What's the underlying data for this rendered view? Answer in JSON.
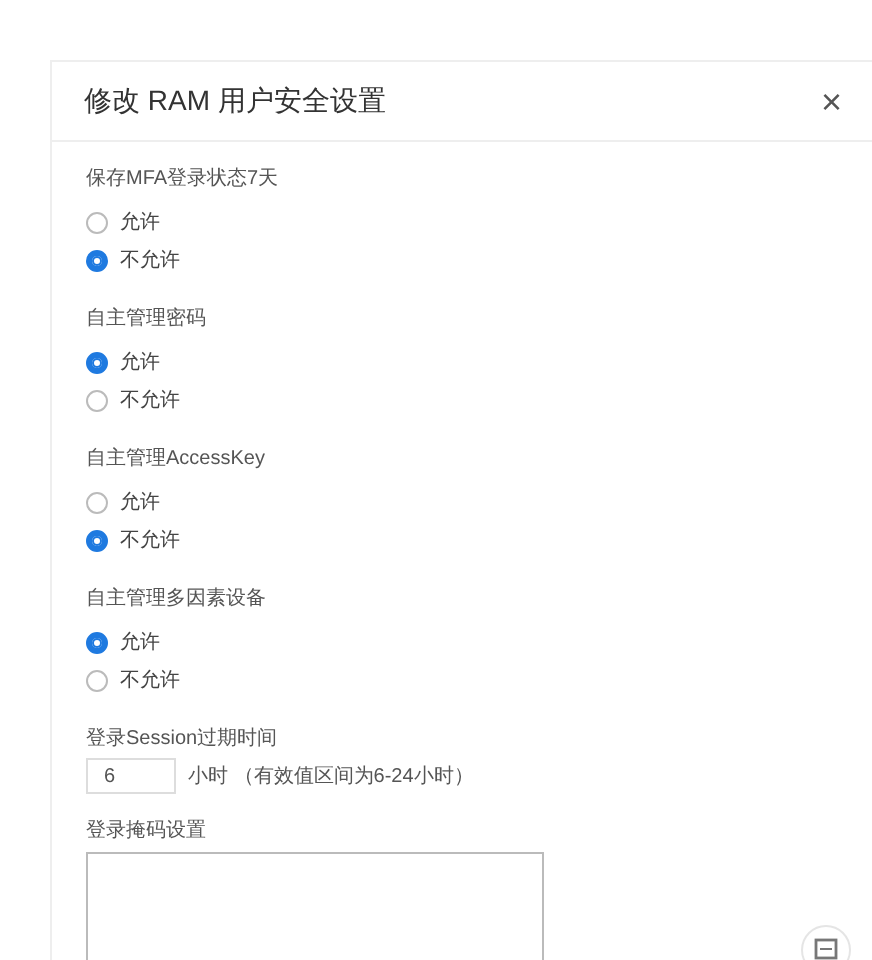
{
  "dialog": {
    "title": "修改 RAM 用户安全设置",
    "close": "×"
  },
  "settings": [
    {
      "label": "保存MFA登录状态7天",
      "options": [
        {
          "label": "允许",
          "selected": false
        },
        {
          "label": "不允许",
          "selected": true
        }
      ]
    },
    {
      "label": "自主管理密码",
      "options": [
        {
          "label": "允许",
          "selected": true
        },
        {
          "label": "不允许",
          "selected": false
        }
      ]
    },
    {
      "label": "自主管理AccessKey",
      "options": [
        {
          "label": "允许",
          "selected": false
        },
        {
          "label": "不允许",
          "selected": true
        }
      ]
    },
    {
      "label": "自主管理多因素设备",
      "options": [
        {
          "label": "允许",
          "selected": true
        },
        {
          "label": "不允许",
          "selected": false
        }
      ]
    }
  ],
  "session": {
    "label": "登录Session过期时间",
    "value": "6",
    "hint": "小时 （有效值区间为6-24小时）"
  },
  "login_mask": {
    "label": "登录掩码设置"
  }
}
